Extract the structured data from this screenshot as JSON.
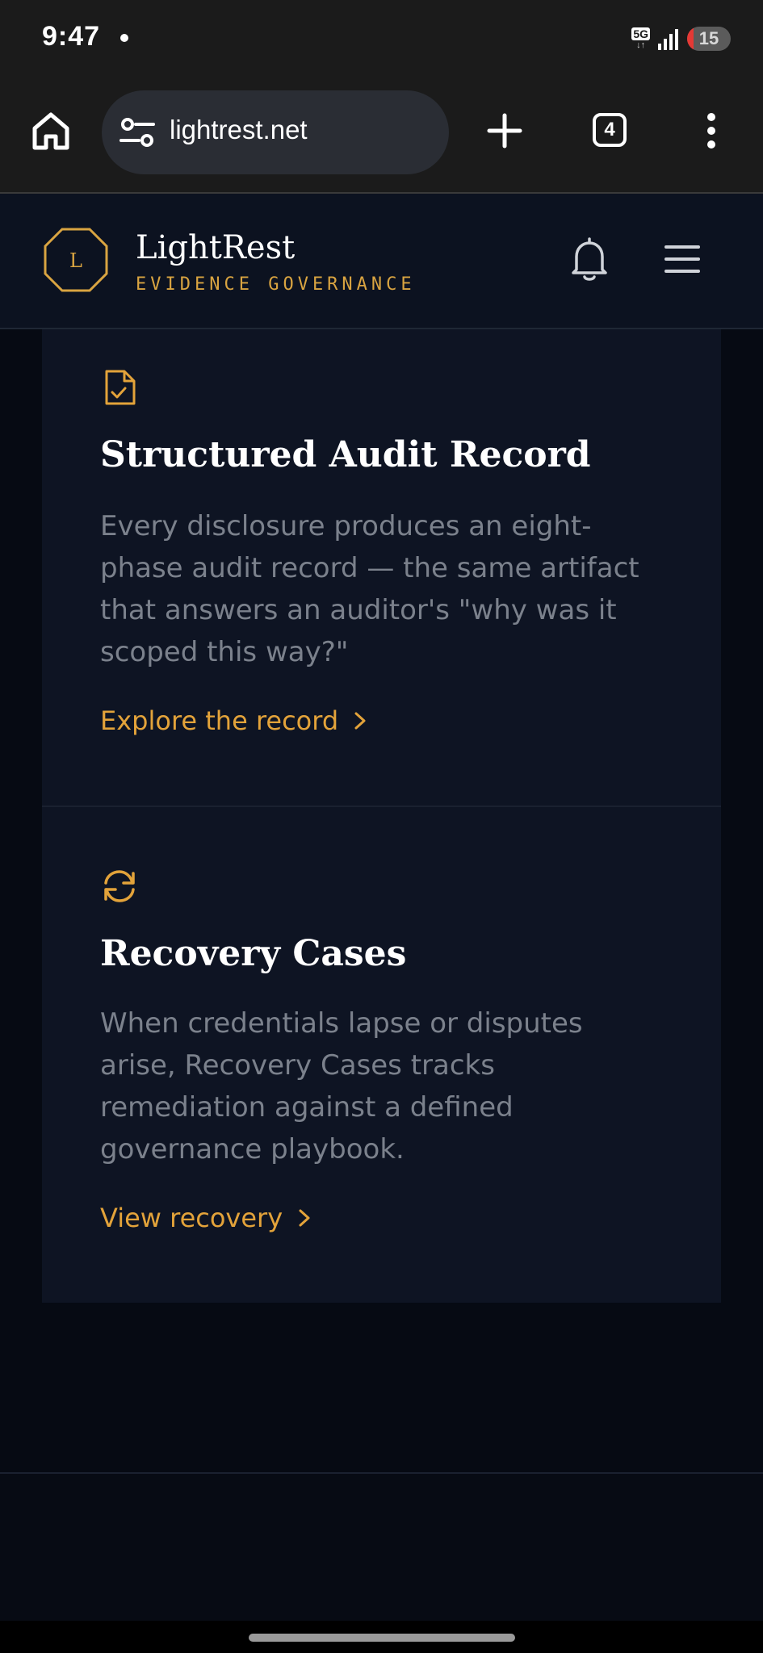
{
  "status_bar": {
    "time": "9:47",
    "network": "5G",
    "network_arrows": "↓↑",
    "battery": "15",
    "battery_level": 0.15
  },
  "browser": {
    "url": "lightrest.net",
    "tab_count": "4"
  },
  "site": {
    "brand_mark": "L",
    "brand_name": "LightRest",
    "brand_tagline": "EVIDENCE GOVERNANCE",
    "accent": "#d9a441"
  },
  "cards": [
    {
      "icon": "file-check-icon",
      "title": "Structured Audit Record",
      "description": "Every disclosure produces an eight-phase audit record — the same artifact that answers an auditor's \"why was it scoped this way?\"",
      "link": "Explore the record"
    },
    {
      "icon": "refresh-icon",
      "title": "Recovery Cases",
      "description": "When credentials lapse or disputes arise, Recovery Cases tracks remediation against a defined governance playbook.",
      "link": "View recovery"
    }
  ]
}
